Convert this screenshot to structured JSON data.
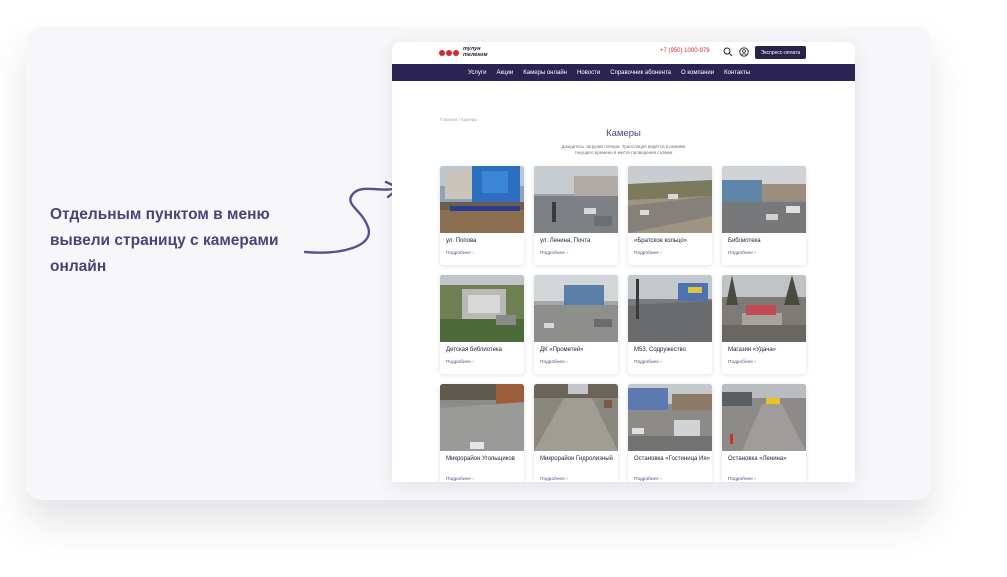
{
  "caption": {
    "line1": "Отдельным пунктом в меню",
    "line2": "вывели страницу с камерами",
    "line3": "онлайн"
  },
  "site": {
    "logo_line1": "тулун",
    "logo_line2": "телеком",
    "phone": "+7 (950) 1000-979",
    "pay_button": "Экспресс-оплата",
    "nav": [
      "Услуги",
      "Акции",
      "Камеры онлайн",
      "Новости",
      "Справочник абонента",
      "О компании",
      "Контакты"
    ],
    "breadcrumb": "Главная / Камеры",
    "title": "Камеры",
    "subtitle": "Дождитесь загрузки плеера. Трансляция ведётся в режиме текущего времени в месте проведения съёмки"
  },
  "cameras": [
    {
      "title": "ул. Попова",
      "more": "Подробнее ›",
      "scene": "building-blue"
    },
    {
      "title": "ул. Ленина, Почта",
      "more": "Подробнее ›",
      "scene": "street-gray"
    },
    {
      "title": "«Братское кольцо»",
      "more": "Подробнее ›",
      "scene": "road-field"
    },
    {
      "title": "Библиотека",
      "more": "Подробнее ›",
      "scene": "street-cars"
    },
    {
      "title": "Детская библиотека",
      "more": "Подробнее ›",
      "scene": "yard-green"
    },
    {
      "title": "ДК «Прометей»",
      "more": "Подробнее ›",
      "scene": "square-snow"
    },
    {
      "title": "М53, Содружество",
      "more": "Подробнее ›",
      "scene": "highway"
    },
    {
      "title": "Магазин «Удача»",
      "more": "Подробнее ›",
      "scene": "trees-square"
    },
    {
      "title": "Микрорайон Угольщиков",
      "more": "Подробнее ›",
      "scene": "bus-green"
    },
    {
      "title": "Микрорайон Гидролизный",
      "more": "Подробнее ›",
      "scene": "empty-road"
    },
    {
      "title": "Остановка «Гостиница Ия»",
      "more": "Подробнее ›",
      "scene": "stop-hotel"
    },
    {
      "title": "Остановка «Ленина»",
      "more": "Подробнее ›",
      "scene": "stop-bus"
    }
  ],
  "colors": {
    "accent": "#4a4279",
    "nav_bg": "#2b2452",
    "brand_red": "#d9262d"
  }
}
